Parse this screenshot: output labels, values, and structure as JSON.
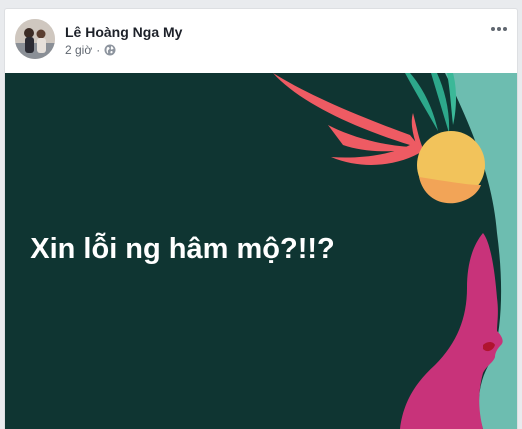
{
  "post": {
    "author": "Lê Hoàng Nga My",
    "time": "2 giờ",
    "separator": "·",
    "privacy_icon": "globe-icon",
    "more_icon": "more-options-icon",
    "image": {
      "headline": "Xin lỗi ng hâm mộ?!!?",
      "colors": {
        "background": "#0f3532",
        "teal": "#6dbdb0",
        "magenta": "#c8337a",
        "coral": "#ee5b63",
        "yellow": "#f2c35b",
        "orange": "#f2a457",
        "leaf": "#2da88b"
      }
    }
  }
}
